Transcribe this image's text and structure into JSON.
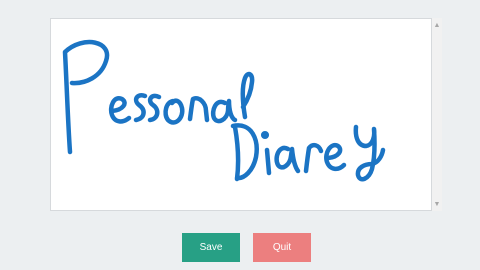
{
  "canvas": {
    "ink_color": "#1b74c4"
  },
  "actions": {
    "save_label": "Save",
    "quit_label": "Quit"
  },
  "colors": {
    "save": "#27a085",
    "quit": "#ec7f7f",
    "background": "#eceff1"
  },
  "icons": {
    "scroll_up": "triangle-up",
    "scroll_down": "triangle-down"
  }
}
